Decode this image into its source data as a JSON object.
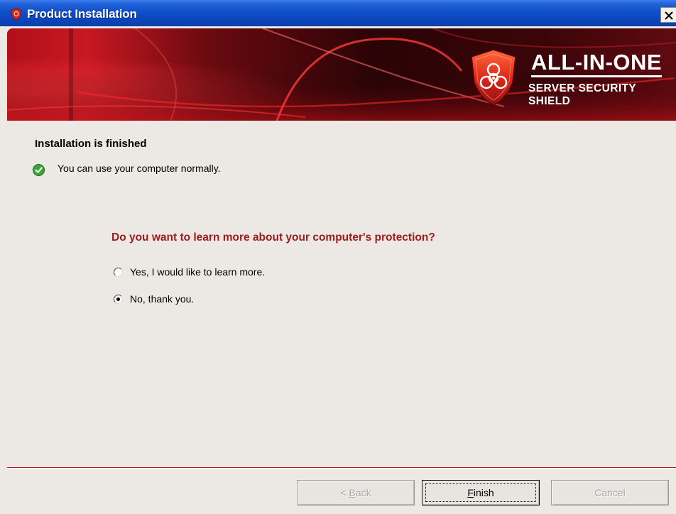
{
  "window": {
    "title": "Product Installation",
    "close_glyph": "✕"
  },
  "banner": {
    "brand_line1": "ALL-IN-ONE",
    "brand_line2": "SERVER SECURITY SHIELD",
    "logo_icon": "biohazard-shield-icon"
  },
  "content": {
    "heading": "Installation is finished",
    "status_text": "You can use your computer normally.",
    "status_icon": "green-check-icon",
    "question": "Do you want to learn more about your computer's protection?",
    "options": [
      {
        "label": "Yes, I would like to learn more.",
        "selected": false
      },
      {
        "label": "No, thank you.",
        "selected": true
      }
    ]
  },
  "buttons": {
    "back": {
      "mnemonic": "B",
      "rest": "ack",
      "prefix": "< ",
      "enabled": false
    },
    "finish": {
      "mnemonic": "F",
      "rest": "inish",
      "enabled": true
    },
    "cancel": {
      "label": "Cancel",
      "enabled": false
    }
  },
  "colors": {
    "title_bar": "#0f4fc9",
    "question_text": "#9c1a1a",
    "banner_red": "#c8101c",
    "separator": "#b02020",
    "check_green": "#3aa63a"
  }
}
